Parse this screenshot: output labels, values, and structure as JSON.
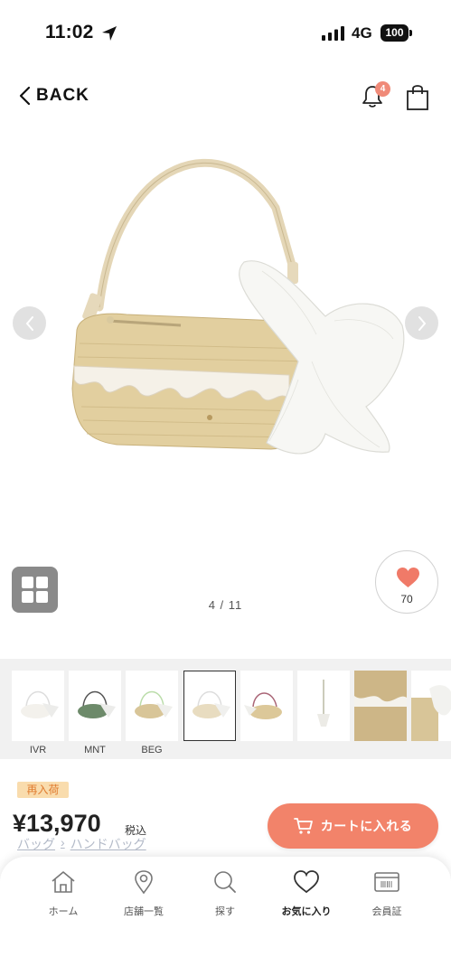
{
  "status_bar": {
    "time": "11:02",
    "network": "4G",
    "battery": "100"
  },
  "header": {
    "back_label": "BACK",
    "notification_count": "4"
  },
  "gallery": {
    "page_indicator": "4 / 11",
    "favorite_count": "70"
  },
  "thumbnails": [
    {
      "label": "IVR"
    },
    {
      "label": "MNT"
    },
    {
      "label": "BEG"
    }
  ],
  "product": {
    "restock_badge": "再入荷",
    "price": "¥13,970",
    "tax_label": "税込",
    "breadcrumb": [
      "バッグ",
      "›",
      "ハンドバッグ"
    ],
    "cart_button_label": "カートに入れる"
  },
  "bottom_nav": {
    "items": [
      {
        "label": "ホーム"
      },
      {
        "label": "店舗一覧"
      },
      {
        "label": "探す"
      },
      {
        "label": "お気に入り"
      },
      {
        "label": "会員証"
      }
    ]
  },
  "colors": {
    "accent": "#f2836a",
    "badge": "#f08a78",
    "restock_bg": "#f9dcad",
    "restock_text": "#e07b2f"
  }
}
